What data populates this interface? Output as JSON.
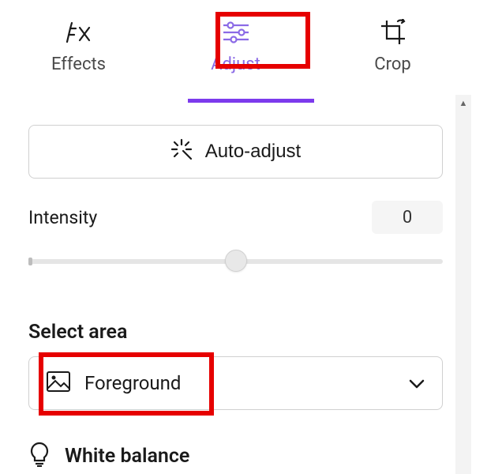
{
  "tabs": {
    "effects": {
      "label": "Effects"
    },
    "adjust": {
      "label": "Adjust"
    },
    "crop": {
      "label": "Crop"
    }
  },
  "auto_adjust": {
    "label": "Auto-adjust"
  },
  "intensity": {
    "label": "Intensity",
    "value": "0"
  },
  "select_area": {
    "heading": "Select area",
    "selected": "Foreground"
  },
  "white_balance": {
    "label": "White balance"
  },
  "colors": {
    "accent": "#7c3aed",
    "highlight": "#e60000"
  }
}
